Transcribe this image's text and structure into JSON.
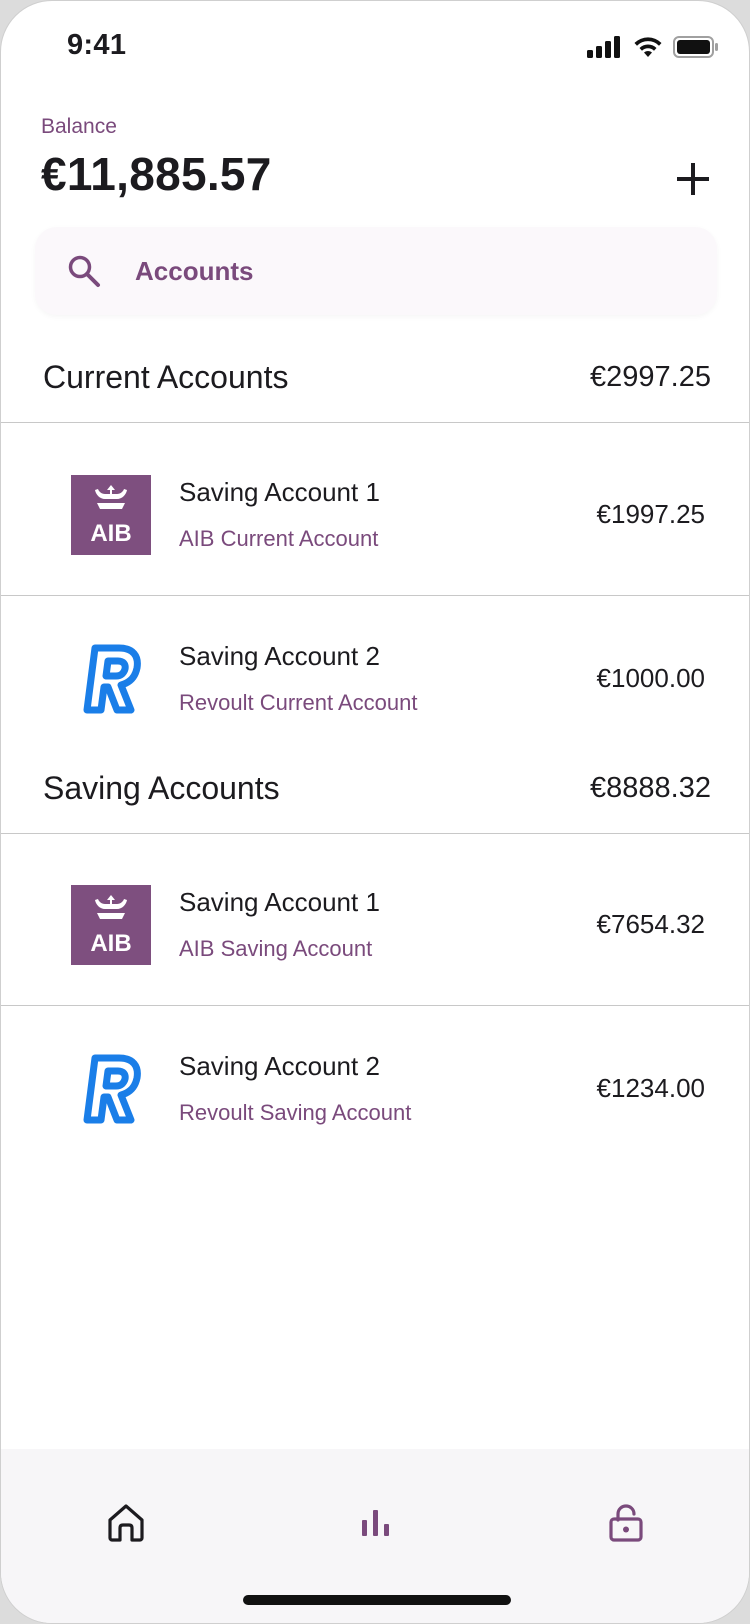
{
  "status_bar": {
    "time": "9:41"
  },
  "header": {
    "balance_label": "Balance",
    "balance_amount": "€11,885.57"
  },
  "search": {
    "placeholder": "Accounts"
  },
  "sections": [
    {
      "title": "Current Accounts",
      "total": "€2997.25",
      "accounts": [
        {
          "name": "Saving Account 1",
          "subtitle": "AIB Current Account",
          "amount": "€1997.25",
          "logo": "aib-logo",
          "logo_text": "AIB"
        },
        {
          "name": "Saving Account 2",
          "subtitle": "Revoult Current Account",
          "amount": "€1000.00",
          "logo": "revolut-logo"
        }
      ]
    },
    {
      "title": "Saving Accounts",
      "total": "€8888.32",
      "accounts": [
        {
          "name": "Saving Account 1",
          "subtitle": "AIB Saving Account",
          "amount": "€7654.32",
          "logo": "aib-logo",
          "logo_text": "AIB"
        },
        {
          "name": "Saving Account 2",
          "subtitle": "Revoult Saving Account",
          "amount": "€1234.00",
          "logo": "revolut-logo"
        }
      ]
    }
  ],
  "bottom_nav": [
    {
      "icon": "home-icon"
    },
    {
      "icon": "bar-chart-icon"
    },
    {
      "icon": "lock-icon"
    }
  ],
  "colors": {
    "accent": "#7a4a7c",
    "aib_purple": "#7e4f7f",
    "revolut_blue": "#1a7ee8"
  }
}
